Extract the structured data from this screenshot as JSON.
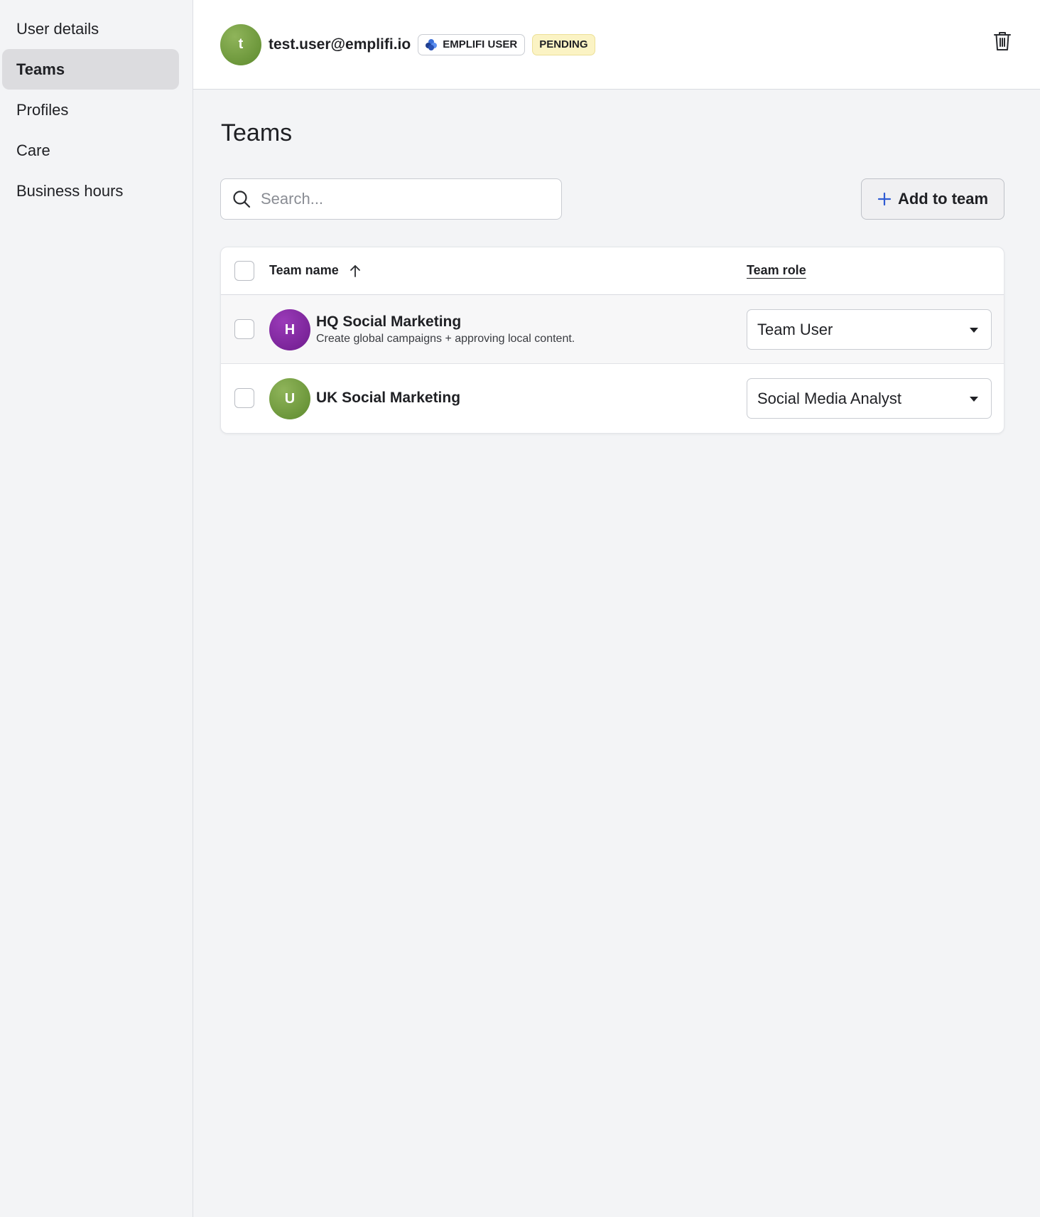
{
  "sidebar": {
    "items": [
      {
        "label": "User details",
        "active": false
      },
      {
        "label": "Teams",
        "active": true
      },
      {
        "label": "Profiles",
        "active": false
      },
      {
        "label": "Care",
        "active": false
      },
      {
        "label": "Business hours",
        "active": false
      }
    ]
  },
  "header": {
    "avatar_initial": "t",
    "email": "test.user@emplifi.io",
    "user_badge": "EMPLIFI USER",
    "status_badge": "PENDING"
  },
  "main": {
    "title": "Teams",
    "search": {
      "placeholder": "Search...",
      "value": ""
    },
    "add_button_label": "Add to team"
  },
  "table": {
    "columns": {
      "name": "Team name",
      "role": "Team role"
    },
    "rows": [
      {
        "initial": "H",
        "name": "HQ Social Marketing",
        "description": "Create global campaigns + approving local content.",
        "role": "Team User"
      },
      {
        "initial": "U",
        "name": "UK Social Marketing",
        "description": "",
        "role": "Social Media Analyst"
      }
    ]
  },
  "colors": {
    "accent": "#2f5bd3",
    "avatar_green": "#6f9a3c",
    "avatar_purple": "#7d26a0",
    "pending_bg": "#fbf3c4",
    "active_nav_bg": "#dcdcdf"
  },
  "icons": {
    "delete": "trash-icon",
    "search": "search-icon",
    "add": "plus-icon",
    "sort": "arrow-up-icon",
    "dropdown": "caret-down-icon",
    "brand": "emplifi-logo-icon"
  }
}
